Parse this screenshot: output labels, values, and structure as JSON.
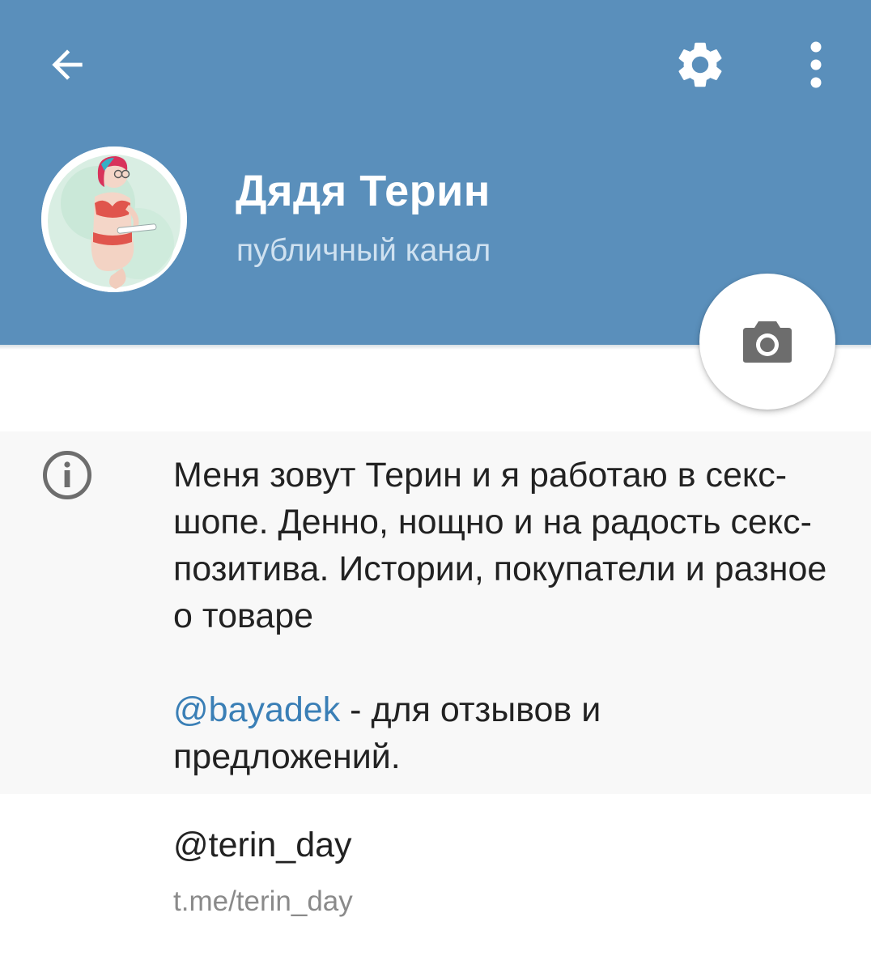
{
  "colors": {
    "header_bg": "#5a8fbb",
    "title_text": "#ffffff",
    "subtitle_text": "#cfe1f0",
    "link_blue": "#3a7fb6",
    "body_text": "#222222",
    "secondary_text": "#8a8a8a",
    "icon_gray": "#6d6d6d"
  },
  "toolbar": {
    "back_icon": "arrow-left-icon",
    "settings_icon": "gear-icon",
    "more_icon": "more-vertical-icon"
  },
  "profile": {
    "name": "Дядя Терин",
    "type": "публичный канал",
    "camera_icon": "camera-icon"
  },
  "info": {
    "icon": "info-icon",
    "description": "Меня зовут Терин и я работаю в секс-шопе. Денно, нощно и на радость секс-позитива. Истории, покупатели и разное о товаре",
    "mention": "@bayadek",
    "mention_suffix": " - для отзывов и предложений."
  },
  "channel_link": {
    "username": "@terin_day",
    "url": "t.me/terin_day"
  }
}
